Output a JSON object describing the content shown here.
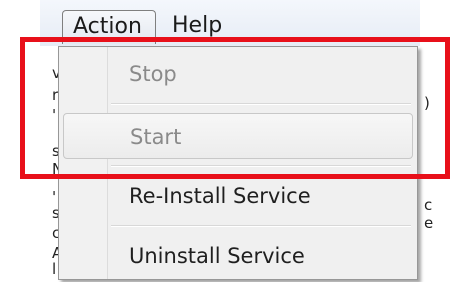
{
  "menubar": {
    "action_label": "Action",
    "help_label": "Help"
  },
  "dropdown": {
    "items": [
      {
        "label": "Stop",
        "enabled": false
      },
      {
        "label": "Start",
        "enabled": false
      },
      {
        "label": "Re-Install Service",
        "enabled": true
      },
      {
        "label": "Uninstall Service",
        "enabled": true
      }
    ]
  },
  "background_fragments": [
    "v",
    "r",
    "'",
    "s",
    "N",
    "'",
    "s",
    "c",
    "A",
    "l",
    ")",
    "c",
    "e"
  ],
  "colors": {
    "annotation": "#e8101a",
    "disabled_text": "#8a8a8a"
  }
}
